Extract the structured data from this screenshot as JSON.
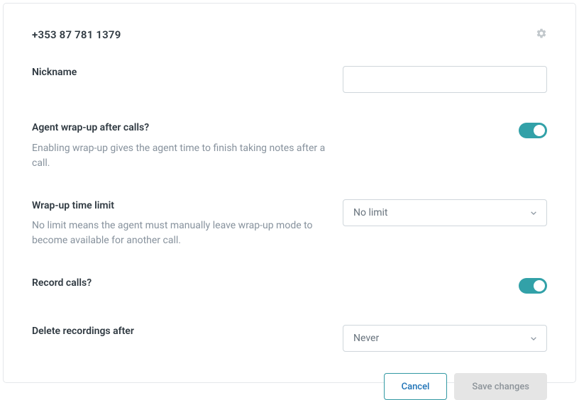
{
  "header": {
    "phone_number": "+353 87 781 1379"
  },
  "fields": {
    "nickname": {
      "label": "Nickname",
      "value": ""
    },
    "wrapup": {
      "label": "Agent wrap-up after calls?",
      "description": "Enabling wrap-up gives the agent time to finish taking notes after a call.",
      "enabled": true
    },
    "wrapup_limit": {
      "label": "Wrap-up time limit",
      "description": "No limit means the agent must manually leave wrap-up mode to become available for another call.",
      "value": "No limit"
    },
    "record_calls": {
      "label": "Record calls?",
      "enabled": true
    },
    "delete_recordings": {
      "label": "Delete recordings after",
      "value": "Never"
    }
  },
  "footer": {
    "cancel": "Cancel",
    "save": "Save changes"
  }
}
